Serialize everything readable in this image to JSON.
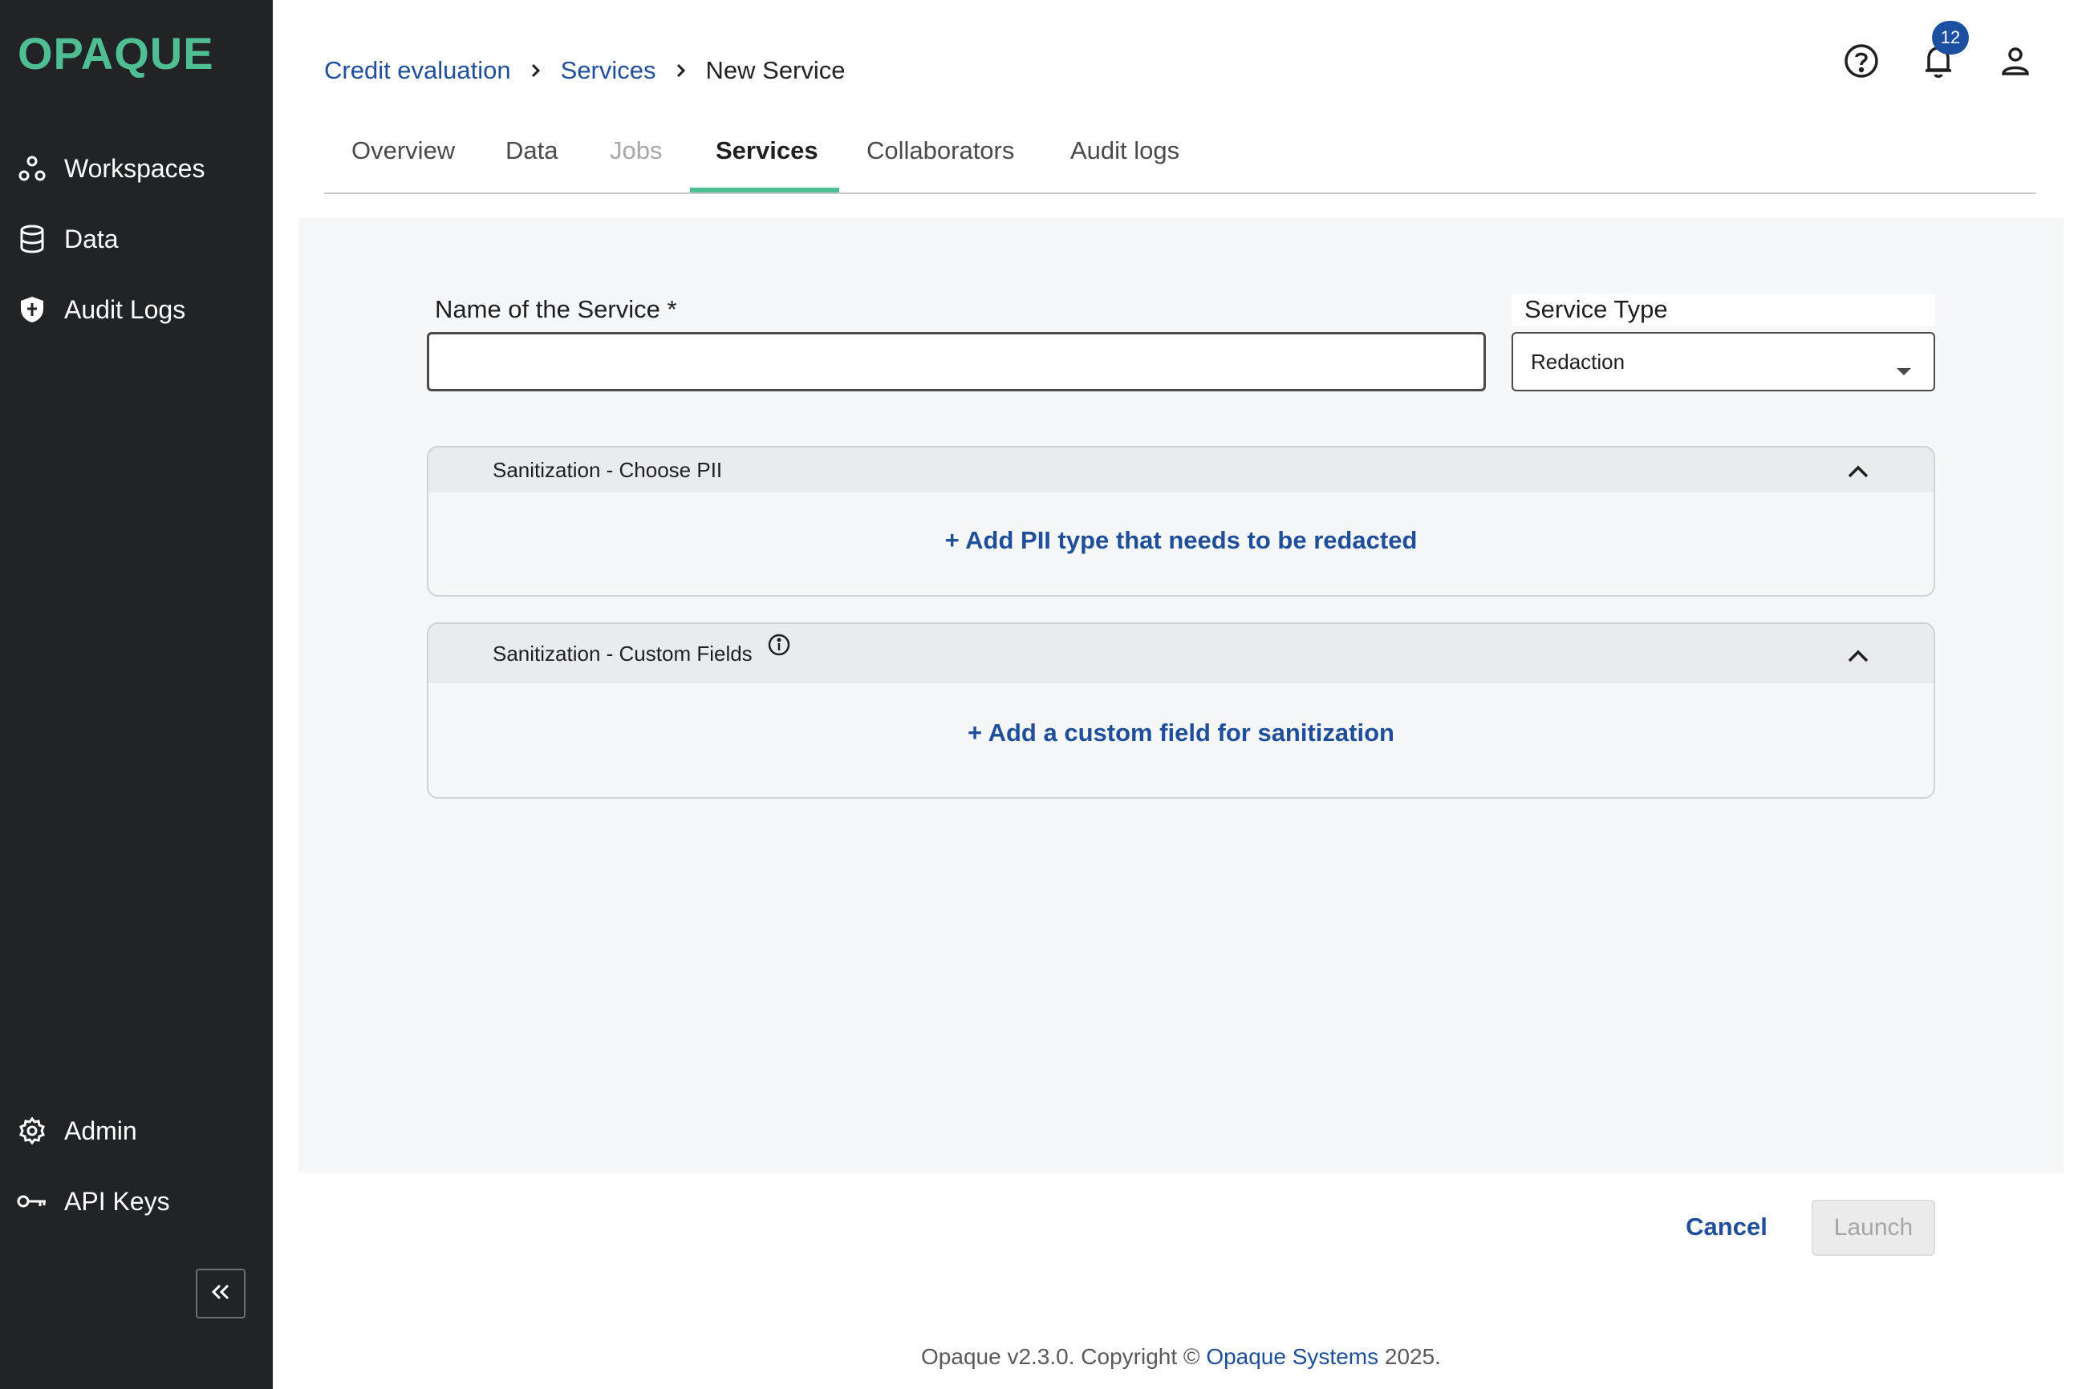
{
  "app": {
    "logo_text": "OPAQUE",
    "accent_color": "#4fbf93",
    "link_color": "#1f4f9a"
  },
  "sidebar": {
    "top_items": [
      {
        "label": "Workspaces",
        "icon": "workspaces-icon"
      },
      {
        "label": "Data",
        "icon": "database-icon"
      },
      {
        "label": "Audit Logs",
        "icon": "shield-icon"
      }
    ],
    "bottom_items": [
      {
        "label": "Admin",
        "icon": "gear-icon"
      },
      {
        "label": "API Keys",
        "icon": "key-icon"
      }
    ],
    "collapse_icon": "double-chevron-left-icon"
  },
  "breadcrumb": {
    "items": [
      "Credit evaluation",
      "Services"
    ],
    "current": "New Service"
  },
  "header": {
    "notification_count": "12"
  },
  "tabs": [
    {
      "label": "Overview",
      "state": "normal"
    },
    {
      "label": "Data",
      "state": "normal"
    },
    {
      "label": "Jobs",
      "state": "disabled"
    },
    {
      "label": "Services",
      "state": "active"
    },
    {
      "label": "Collaborators",
      "state": "normal"
    },
    {
      "label": "Audit logs",
      "state": "normal"
    }
  ],
  "form": {
    "name_label": "Name of the Service *",
    "name_value": "",
    "service_type_label": "Service Type",
    "service_type_value": "Redaction"
  },
  "sections": [
    {
      "title": "Sanitization - Choose PII",
      "action": "+ Add PII type that needs to be redacted",
      "info": false
    },
    {
      "title": "Sanitization - Custom Fields",
      "action": "+ Add a custom field for sanitization",
      "info": true
    }
  ],
  "footer": {
    "cancel_label": "Cancel",
    "launch_label": "Launch",
    "copyright_prefix": "Opaque v2.3.0. Copyright ©",
    "copyright_link": "Opaque Systems",
    "copyright_suffix": "2025."
  }
}
